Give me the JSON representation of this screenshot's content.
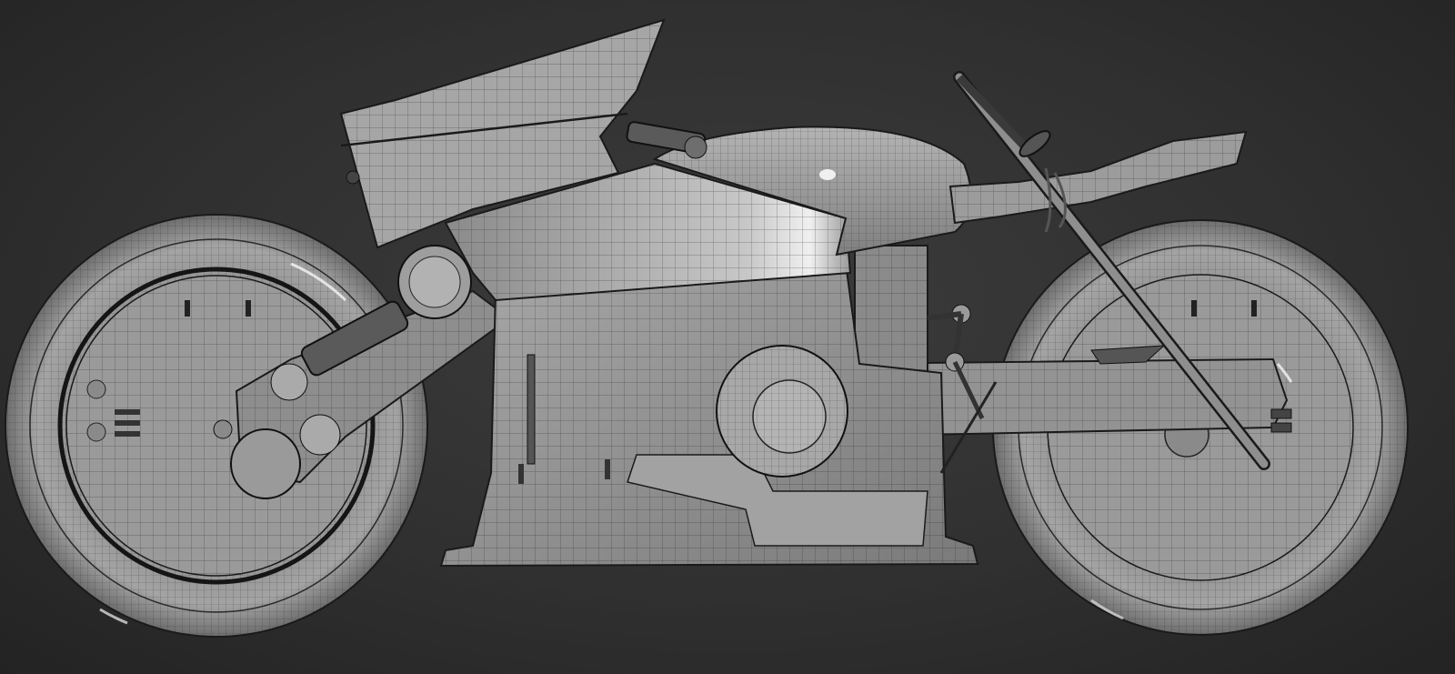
{
  "viewport": {
    "background_color": "#333333",
    "render_style": "wireframe-on-shaded",
    "subject": "motorcycle",
    "view": "side"
  },
  "model": {
    "base_color": "#9a9a9a",
    "wire_color": "#1e1e1e",
    "highlight_color": "#f2f2f2"
  }
}
